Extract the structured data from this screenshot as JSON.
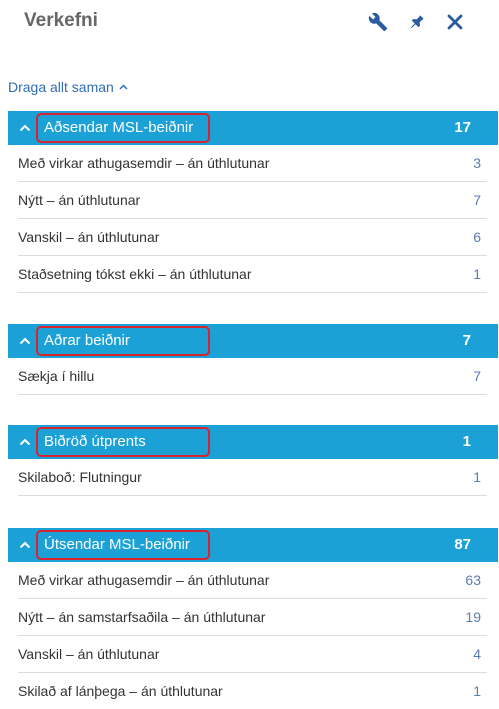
{
  "header": {
    "title": "Verkefni"
  },
  "toolbar": {
    "collapse_all_label": "Draga allt saman"
  },
  "sections": [
    {
      "title": "Aðsendar MSL-beiðnir",
      "count": "17",
      "items": [
        {
          "label": "Með virkar athugasemdir – án úthlutunar",
          "count": "3"
        },
        {
          "label": "Nýtt – án úthlutunar",
          "count": "7"
        },
        {
          "label": "Vanskil – án úthlutunar",
          "count": "6"
        },
        {
          "label": "Staðsetning tókst ekki – án úthlutunar",
          "count": "1"
        }
      ]
    },
    {
      "title": "Aðrar beiðnir",
      "count": "7",
      "items": [
        {
          "label": "Sækja í hillu",
          "count": "7"
        }
      ]
    },
    {
      "title": "Biðröð útprents",
      "count": "1",
      "items": [
        {
          "label": "Skilaboð: Flutningur",
          "count": "1"
        }
      ]
    },
    {
      "title": "Útsendar MSL-beiðnir",
      "count": "87",
      "items": [
        {
          "label": "Með virkar athugasemdir – án úthlutunar",
          "count": "63"
        },
        {
          "label": "Nýtt – án samstarfsaðila – án úthlutunar",
          "count": "19"
        },
        {
          "label": "Vanskil – án úthlutunar",
          "count": "4"
        },
        {
          "label": "Skilað af lánþega – án úthlutunar",
          "count": "1"
        }
      ]
    }
  ],
  "colors": {
    "section_header_bg": "#1ba1d6",
    "highlight_border": "#d9232e",
    "link": "#2f6db5",
    "icon": "#2b5aa0",
    "count_text": "#5b7dae"
  },
  "icons": {
    "settings": "wrench-icon",
    "pin": "pin-icon",
    "close": "close-icon",
    "collapse": "chevron-up-icon"
  }
}
